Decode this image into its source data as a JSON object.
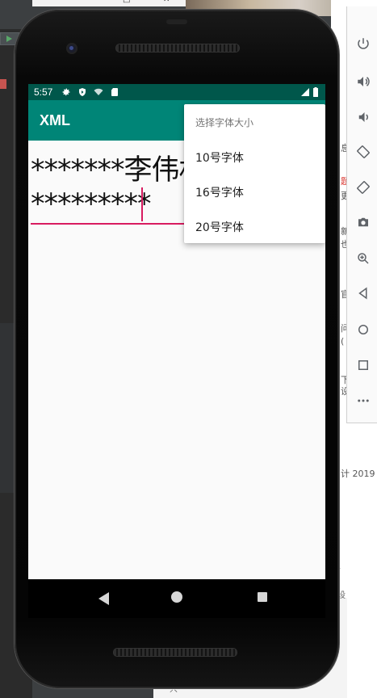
{
  "desktop": {
    "topbar_labels": [
      "—",
      "□",
      "✕"
    ],
    "right_text": [
      "息",
      "题",
      "更",
      "新",
      "也",
      "官",
      "问",
      "(",
      "下",
      "设",
      "计 2019"
    ],
    "bottom_text": [
      "只",
      "沿",
      "设"
    ]
  },
  "emulator_toolbar": {
    "buttons": [
      "power-icon",
      "volume-up-icon",
      "volume-down-icon",
      "rotate-left-icon",
      "rotate-right-icon",
      "camera-icon",
      "zoom-icon",
      "back-icon",
      "home-icon",
      "overview-icon",
      "more-icon"
    ]
  },
  "statusbar": {
    "time": "5:57",
    "icons": [
      "settings-icon",
      "shield-icon",
      "wifi-icon",
      "sd-card-icon",
      "signal-icon",
      "battery-icon"
    ]
  },
  "appbar": {
    "title": "XML"
  },
  "content": {
    "line1": "*******李伟林",
    "line2": "*********"
  },
  "menu": {
    "header": "选择字体大小",
    "items": [
      {
        "label": "10号字体"
      },
      {
        "label": "16号字体"
      },
      {
        "label": "20号字体"
      }
    ]
  },
  "colors": {
    "status_bar": "#00574B",
    "app_bar": "#008577",
    "accent": "#D81B60"
  }
}
